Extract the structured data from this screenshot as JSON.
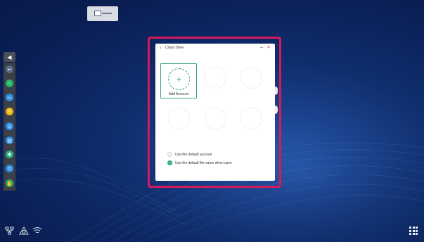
{
  "dialog": {
    "title": "Cloud Drive",
    "add_account_label": "Add Account",
    "add_symbol": "+",
    "option_default_account": "Use the default account",
    "option_default_filename": "Use the default file name when save",
    "default_account_checked": false,
    "default_filename_checked": true
  },
  "controls": {
    "back": "‹",
    "minimize": "–",
    "close": "×",
    "collapse": "◀",
    "check": "✓"
  },
  "colors": {
    "accent": "#3aa57e",
    "highlight_frame": "#d6195a",
    "close": "#dd2233"
  },
  "toolbar": {
    "tools": [
      {
        "name": "back-tool",
        "icon": "↩",
        "color": "#5a6b86"
      },
      {
        "name": "home-tool",
        "icon": "⌂",
        "color": "#27b36a"
      },
      {
        "name": "window-tool",
        "icon": "▭",
        "color": "#2a8ee8"
      },
      {
        "name": "pen-tool",
        "icon": "✎",
        "color": "#f0b51c"
      },
      {
        "name": "screenshot-tool",
        "icon": "⊡",
        "color": "#2a8ee8"
      },
      {
        "name": "board-tool",
        "icon": "▤",
        "color": "#2a8ee8"
      },
      {
        "name": "settings-tool",
        "icon": "✱",
        "color": "#27b389"
      },
      {
        "name": "input-tool",
        "icon": "⇆",
        "color": "#2a8ee8"
      },
      {
        "name": "annotate-tool",
        "icon": "✋",
        "color": "#27b36a"
      }
    ]
  },
  "status": {
    "network_icon": "network-icon",
    "cloud_icon": "cloud-icon",
    "wifi_icon": "wifi-icon",
    "apps_icon": "apps-grid-icon"
  }
}
